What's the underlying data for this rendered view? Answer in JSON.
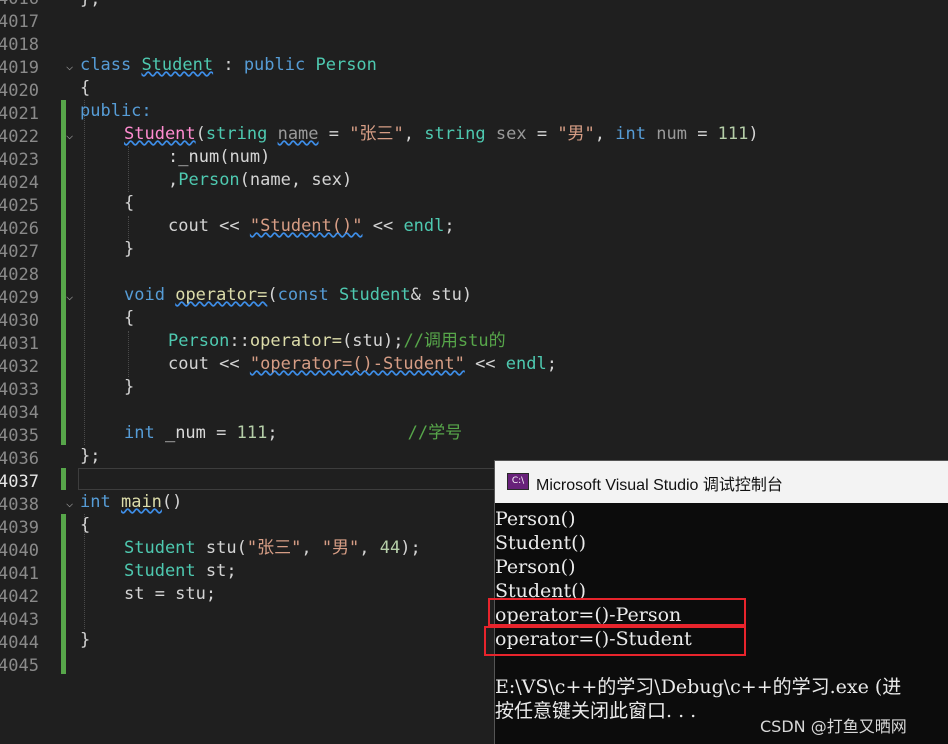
{
  "editor": {
    "line_numbers": [
      "4016",
      "4017",
      "4018",
      "4019",
      "4020",
      "4021",
      "4022",
      "4023",
      "4024",
      "4025",
      "4026",
      "4027",
      "4028",
      "4029",
      "4030",
      "4031",
      "4032",
      "4033",
      "4034",
      "4035",
      "4036",
      "4037",
      "4038",
      "4039",
      "4040",
      "4041",
      "4042",
      "4043",
      "4044",
      "4045"
    ],
    "current_line": "4037",
    "lines": {
      "l4016": "};",
      "l4019_kw": "class",
      "l4019_name": "Student",
      "l4019_colon": " : ",
      "l4019_pub": "public",
      "l4019_base": "Person",
      "l4020": "{",
      "l4021": "public:",
      "l4022_ctor": "Student",
      "l4022_p1": "(",
      "l4022_t1": "string",
      "l4022_a1": "name",
      "l4022_eq1": " = ",
      "l4022_s1": "\"张三\"",
      "l4022_c1": ", ",
      "l4022_t2": "string",
      "l4022_a2": " sex",
      "l4022_eq2": " = ",
      "l4022_s2": "\"男\"",
      "l4022_c2": ", ",
      "l4022_t3": "int",
      "l4022_a3": " num",
      "l4022_eq3": " = ",
      "l4022_n3": "111",
      "l4022_end": ")",
      "l4023_pre": ":",
      "l4023_mb": "_num",
      "l4023_arg": "(num)",
      "l4024_pre": ",",
      "l4024_ty": "Person",
      "l4024_arg": "(name, sex)",
      "l4025": "{",
      "l4026_a": "cout << ",
      "l4026_s": "\"Student()\"",
      "l4026_b": " << ",
      "l4026_e": "endl",
      "l4026_c": ";",
      "l4027": "}",
      "l4029_kw": "void",
      "l4029_op": "operator=",
      "l4029_p": "(",
      "l4029_c": "const",
      "l4029_ty": " Student",
      "l4029_r": "& stu)",
      "l4030": "{",
      "l4031_ty": "Person",
      "l4031_sep": "::",
      "l4031_op": "operator=",
      "l4031_arg": "(stu);",
      "l4031_cm": "//调用stu的",
      "l4032_a": "cout << ",
      "l4032_s": "\"operator=()-Student\"",
      "l4032_b": " << ",
      "l4032_e": "endl",
      "l4032_c": ";",
      "l4033": "}",
      "l4035_kw": "int",
      "l4035_mb": " _num",
      "l4035_eq": " = ",
      "l4035_n": "111",
      "l4035_sc": ";",
      "l4035_cm": "//学号",
      "l4036": "};",
      "l4038_kw": "int",
      "l4038_fn": "main",
      "l4038_p": "()",
      "l4039": "{",
      "l4040_ty": "Student",
      "l4040_a": " stu(",
      "l4040_s1": "\"张三\"",
      "l4040_c": ", ",
      "l4040_s2": "\"男\"",
      "l4040_d": ", ",
      "l4040_n": "44",
      "l4040_e": ");",
      "l4041_ty": "Student",
      "l4041_a": " st;",
      "l4042": "st = stu;",
      "l4044": "}"
    }
  },
  "console": {
    "title": "Microsoft Visual Studio 调试控制台",
    "icon_label": "C:\\",
    "lines": [
      "Person()",
      "Student()",
      "Person()",
      "Student()",
      "operator=()-Person",
      "operator=()-Student",
      "",
      "E:\\VS\\c++的学习\\Debug\\c++的学习.exe (进",
      "按任意键关闭此窗口. . ."
    ],
    "highlight_color": "#e8242c"
  },
  "watermark": "CSDN @打鱼又晒网",
  "colors": {
    "bg": "#1f1f1f",
    "change_bar": "#57a64a",
    "keyword": "#569cd6",
    "type": "#4ec9b0",
    "string": "#d69d85",
    "comment": "#57a64a"
  }
}
